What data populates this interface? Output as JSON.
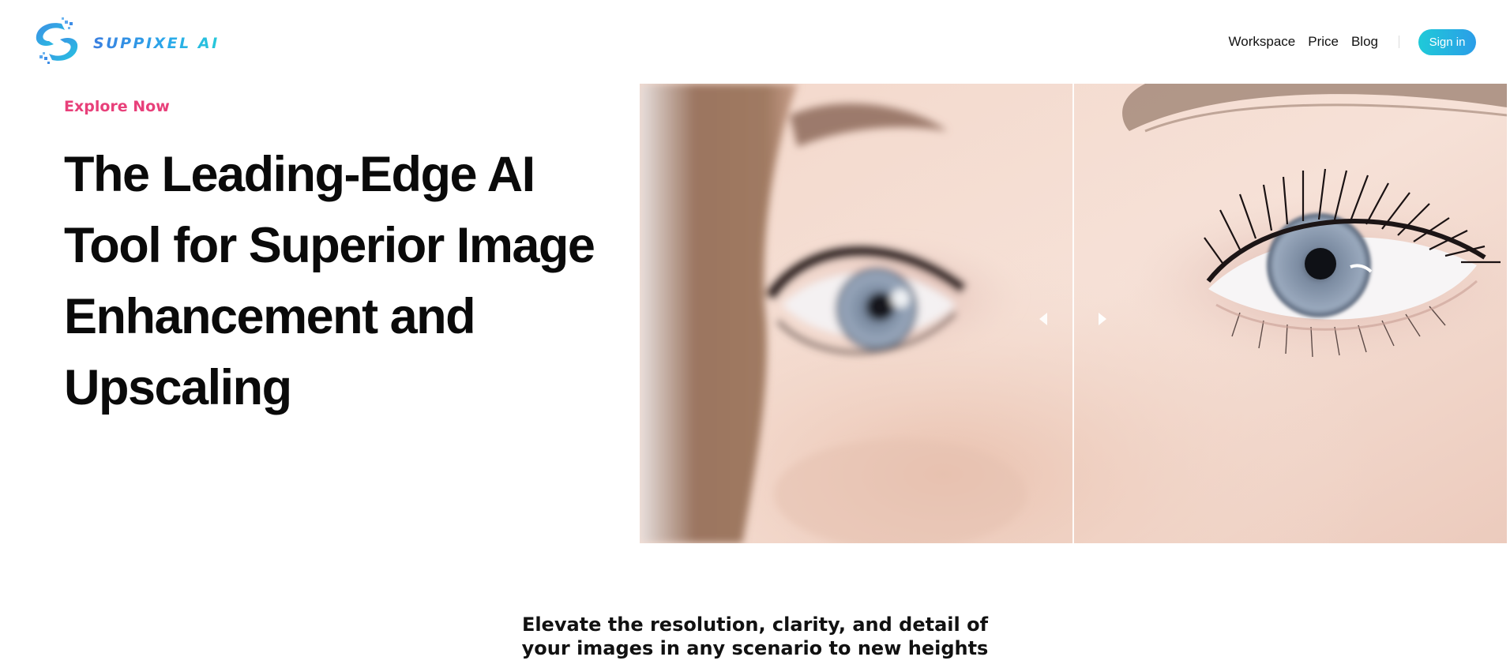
{
  "brand": {
    "name": "SUPPIXEL AI",
    "logo_icon": "s-swirl-pixel-icon"
  },
  "nav": {
    "links": [
      "Workspace",
      "Price",
      "Blog"
    ],
    "signin_label": "Sign in"
  },
  "hero": {
    "eyebrow": "Explore Now",
    "headline_lines": [
      "The Leading-Edge AI",
      "Tool for Superior Image",
      "Enhancement and",
      "Upscaling"
    ],
    "compare_image": {
      "left_label": "before-blurry",
      "right_label": "after-enhanced",
      "handle_icons": [
        "arrow-left-icon",
        "arrow-right-icon"
      ]
    }
  },
  "tagline_lines": [
    "Elevate the resolution, clarity, and detail of",
    "your images in any scenario to new heights"
  ],
  "colors": {
    "accent_pink": "#e8407a",
    "brand_blue": "#3a7fe0",
    "brand_cyan": "#1fcad8",
    "text": "#0a0a0a"
  }
}
